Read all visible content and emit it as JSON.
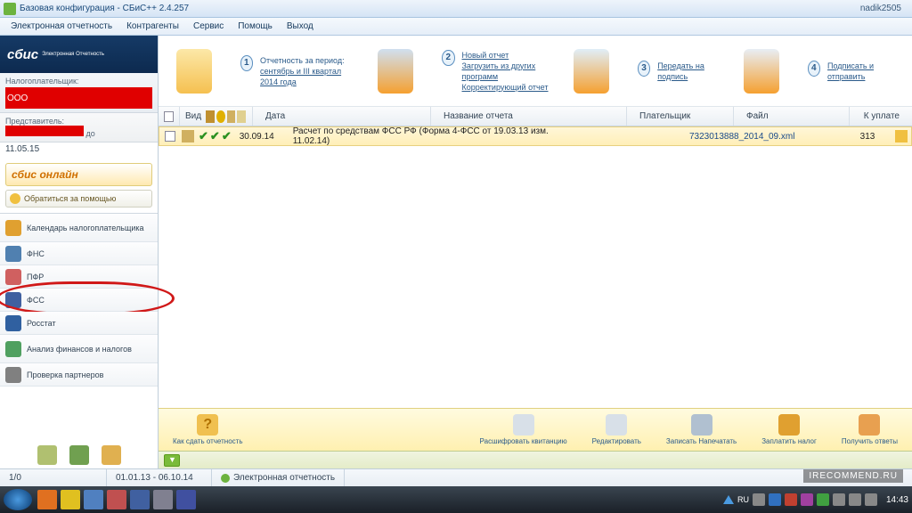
{
  "window": {
    "title": "Базовая конфигурация - СБиС++ 2.4.257",
    "username": "nadik2505"
  },
  "menu": {
    "items": [
      "Электронная отчетность",
      "Контрагенты",
      "Сервис",
      "Помощь",
      "Выход"
    ]
  },
  "sidebar": {
    "logo": "сбис",
    "logo_sub": "Электронная Отчетность",
    "taxpayer_label": "Налогоплательщик:",
    "taxpayer_value": "ООО",
    "representative_label": "Представитель:",
    "rep_until": "до",
    "rep_date": "11.05.15",
    "online_label": "сбис онлайн",
    "help_label": "Обратиться за помощью",
    "nav": [
      {
        "label": "Календарь налогоплательщика",
        "icon_bg": "#e0a030"
      },
      {
        "label": "ФНС",
        "icon_bg": "#5080b0"
      },
      {
        "label": "ПФР",
        "icon_bg": "#d06060"
      },
      {
        "label": "ФСС",
        "icon_bg": "#4060a0"
      },
      {
        "label": "Росстат",
        "icon_bg": "#3060a0"
      },
      {
        "label": "Анализ финансов и налогов",
        "icon_bg": "#50a060"
      },
      {
        "label": "Проверка партнеров",
        "icon_bg": "#808080"
      }
    ],
    "circled_index": 3
  },
  "steps": [
    {
      "num": "1",
      "lines": [
        "Отчетность за период:",
        "сентябрь и III квартал 2014 года"
      ]
    },
    {
      "num": "2",
      "lines": [
        "Новый отчет",
        "Загрузить из других программ",
        "Корректирующий отчет"
      ]
    },
    {
      "num": "3",
      "lines": [
        "Передать на подпись"
      ]
    },
    {
      "num": "4",
      "lines": [
        "Подписать и отправить"
      ]
    }
  ],
  "columns": {
    "vid": "Вид",
    "date": "Дата",
    "name": "Название отчета",
    "payer": "Плательщик",
    "file": "Файл",
    "to_pay": "К уплате"
  },
  "row": {
    "date": "30.09.14",
    "name": "Расчет по средствам ФСС РФ (Форма 4-ФСС от 19.03.13 изм. 11.02.14)",
    "file": "7323013888_2014_09.xml",
    "to_pay": "313"
  },
  "actions": {
    "how": "Как сдать отчетность",
    "decrypt": "Расшифровать квитанцию",
    "edit": "Редактировать",
    "save_print": "Записать Напечатать",
    "pay_tax": "Заплатить налог",
    "get_answers": "Получить ответы"
  },
  "status": {
    "page": "1/0",
    "range": "01.01.13 - 06.10.14",
    "mode": "Электронная отчетность",
    "lang": "RU",
    "time": "14:43"
  },
  "watermark": "IRECOMMEND.RU"
}
